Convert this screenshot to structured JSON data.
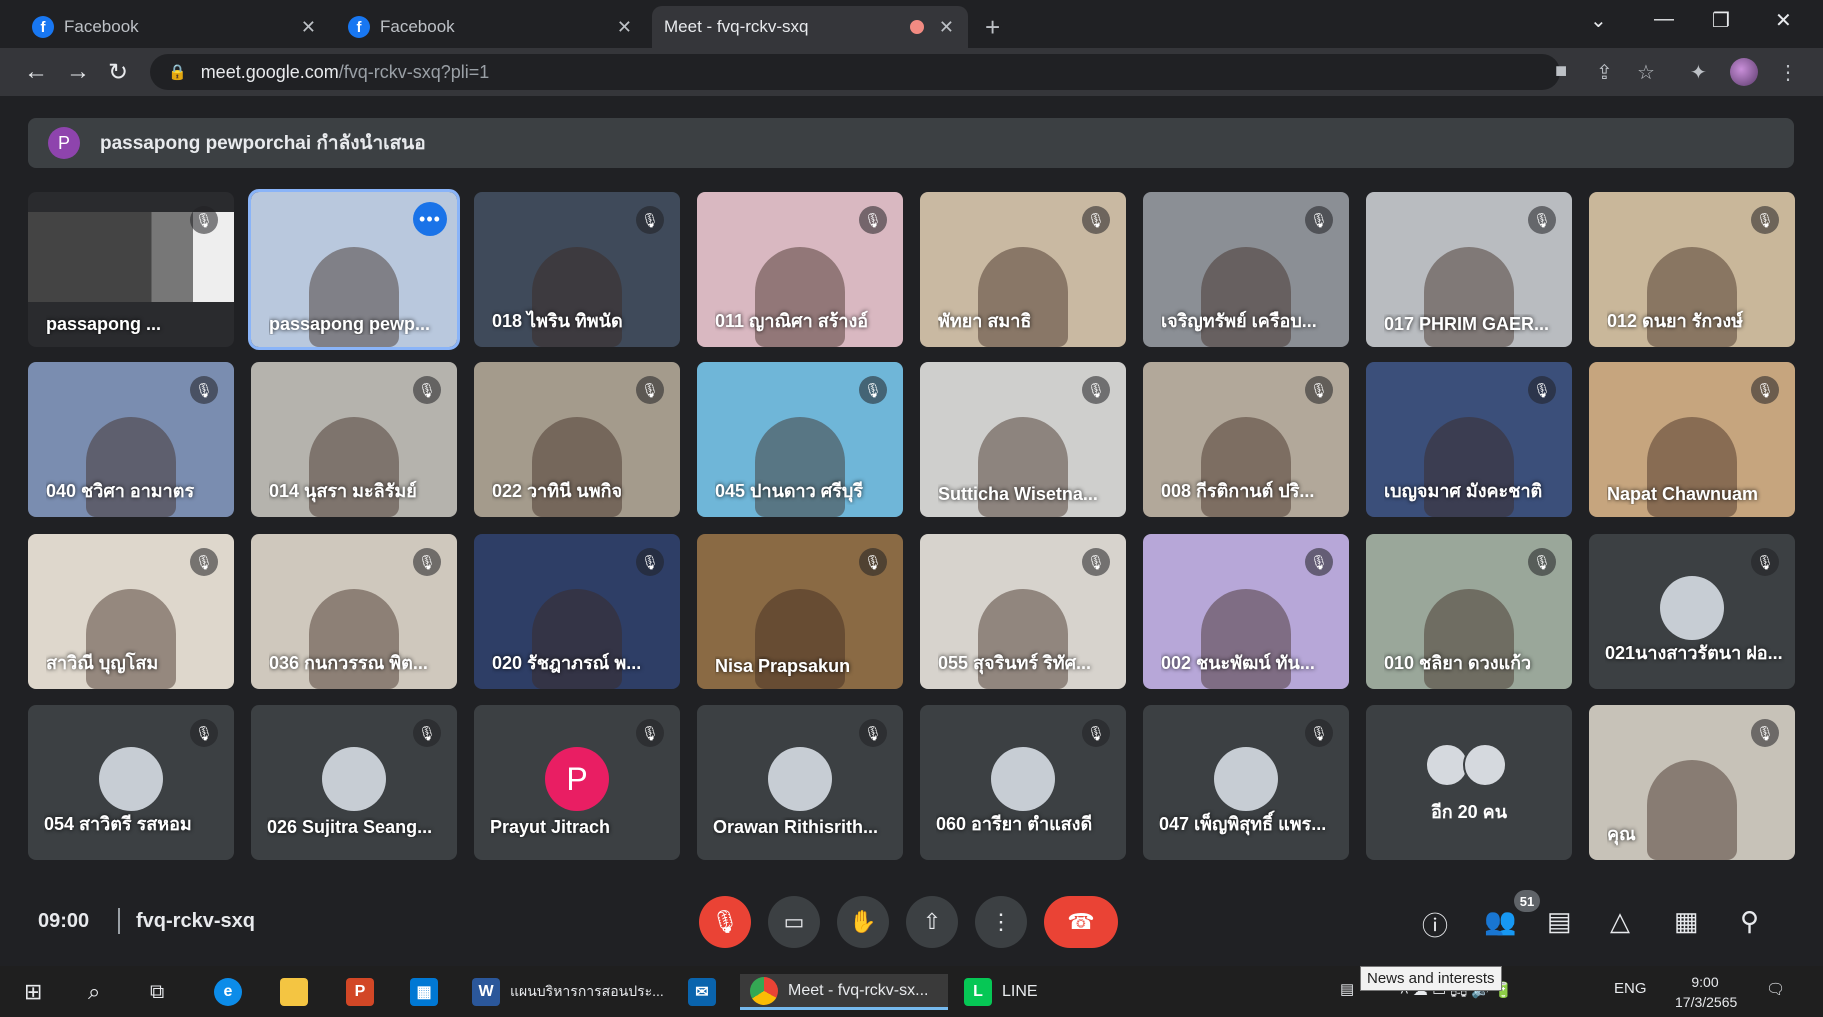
{
  "browser": {
    "tabs": [
      {
        "title": "Facebook",
        "icon": "facebook-icon",
        "active": false
      },
      {
        "title": "Facebook",
        "icon": "facebook-icon",
        "active": false
      },
      {
        "title": "Meet - fvq-rckv-sxq",
        "icon": "google-meet-icon",
        "active": true
      }
    ],
    "url_host": "meet.google.com",
    "url_path": "/fvq-rckv-sxq?pli=1"
  },
  "meet": {
    "presenter_initial": "P",
    "presenter_text": "passapong pewporchai กำลังนำเสนอ",
    "tiles": [
      {
        "name": "passapong ...",
        "type": "screen",
        "bg": "#2a2b2e"
      },
      {
        "name": "passapong pewp...",
        "type": "video",
        "bg": "#b9c8dd",
        "highlight": true
      },
      {
        "name": "018 ไพริน ทิพนัด",
        "type": "video",
        "bg": "#3f4a5a"
      },
      {
        "name": "011 ญาณิศา สร้างอ์",
        "type": "video",
        "bg": "#d9b8c1"
      },
      {
        "name": "พัทยา สมาธิ",
        "type": "video",
        "bg": "#c9b9a2"
      },
      {
        "name": "เจริญทรัพย์ เครือบ...",
        "type": "video",
        "bg": "#8b8f95"
      },
      {
        "name": "017 PHRIM GAER...",
        "type": "video",
        "bg": "#b9bcc0"
      },
      {
        "name": "012 ดนยา รักวงษ์",
        "type": "video",
        "bg": "#c9b79a"
      },
      {
        "name": "040 ชวิศา อามาตร",
        "type": "video",
        "bg": "#7a8db0"
      },
      {
        "name": "014 นุสรา มะลิรัมย์",
        "type": "video",
        "bg": "#b5b3ad"
      },
      {
        "name": "022 วาทินี นพกิจ",
        "type": "video",
        "bg": "#a49b8c"
      },
      {
        "name": "045 ปานดาว ศรีบุรี",
        "type": "video",
        "bg": "#6fb6d8"
      },
      {
        "name": "Sutticha Wisetna...",
        "type": "video",
        "bg": "#cfcfcd"
      },
      {
        "name": "008 กีรติกานต์ ปริ...",
        "type": "video",
        "bg": "#b2a89a"
      },
      {
        "name": "เบญจมาศ มังคะชาติ",
        "type": "video",
        "bg": "#3b4f7a"
      },
      {
        "name": "Napat Chawnuam",
        "type": "video",
        "bg": "#c6a57e"
      },
      {
        "name": "สาวิณี บุญโสม",
        "type": "video",
        "bg": "#ded7cc"
      },
      {
        "name": "036 กนกวรรณ พิต...",
        "type": "video",
        "bg": "#cfc8bd"
      },
      {
        "name": "020 รัชฎาภรณ์ พ...",
        "type": "video",
        "bg": "#2e3e66"
      },
      {
        "name": "Nisa Prapsakun",
        "type": "video",
        "bg": "#8a6a44"
      },
      {
        "name": "055 สุจรินทร์ ริทัศ...",
        "type": "video",
        "bg": "#d7d3cd"
      },
      {
        "name": "002 ชนะพัฒน์ ทัน...",
        "type": "video",
        "bg": "#b7a7d8"
      },
      {
        "name": "010 ชลิยา ดวงแก้ว",
        "type": "video",
        "bg": "#9aa79a"
      },
      {
        "name": "021นางสาวรัตนา ฝอ...",
        "type": "avatar",
        "bg": "#3c4043"
      },
      {
        "name": "054 สาวิตรี รสหอม",
        "type": "avatar",
        "bg": "#3c4043"
      },
      {
        "name": "026 Sujitra Seang...",
        "type": "avatar",
        "bg": "#3c4043"
      },
      {
        "name": "Prayut Jitrach",
        "type": "letter",
        "initial": "P",
        "bg": "#3c4043"
      },
      {
        "name": "Orawan Rithisrith...",
        "type": "avatar",
        "bg": "#3c4043"
      },
      {
        "name": "060 อารียา ตำแสงดี",
        "type": "avatar",
        "bg": "#3c4043"
      },
      {
        "name": "047 เพ็ญพิสุทธิ์ แพร...",
        "type": "avatar",
        "bg": "#3c4043"
      },
      {
        "name": "อีก 20 คน",
        "type": "others",
        "bg": "#3c4043"
      },
      {
        "name": "คุณ",
        "type": "video",
        "bg": "#c7c2b8"
      }
    ],
    "time": "09:00",
    "meeting_code": "fvq-rckv-sxq",
    "participant_count": "51"
  },
  "taskbar": {
    "items": [
      {
        "label": "แผนบริหารการสอนประ...",
        "icon": "word-icon"
      },
      {
        "label": "Meet - fvq-rckv-sx...",
        "icon": "chrome-icon"
      },
      {
        "label": "LINE",
        "icon": "line-icon"
      }
    ],
    "tooltip": "News and interests",
    "lang": "ENG",
    "clock_time": "9:00",
    "clock_date": "17/3/2565"
  }
}
